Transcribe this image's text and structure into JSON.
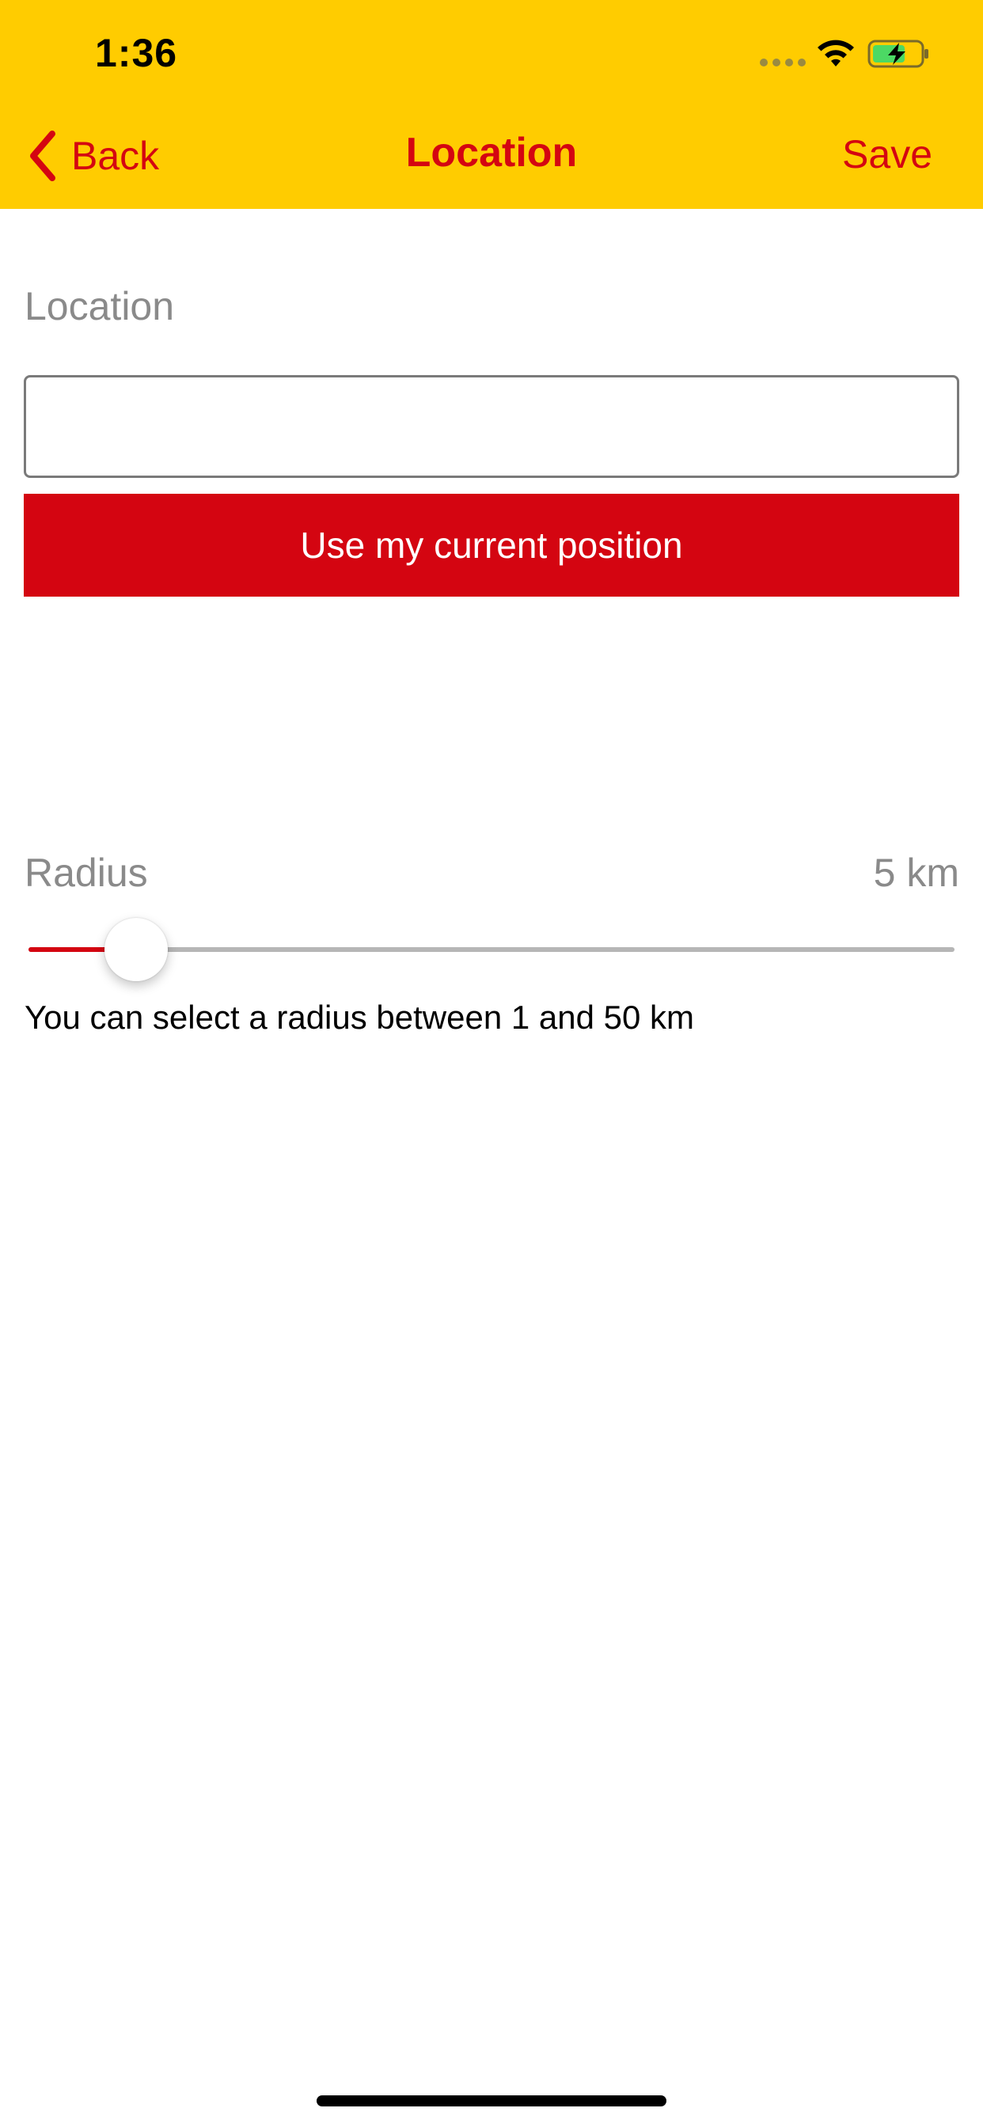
{
  "status_bar": {
    "time": "1:36",
    "icons": [
      "cellular-signal-icon",
      "wifi-icon",
      "battery-charging-icon"
    ],
    "battery_color": "#4CD964"
  },
  "nav": {
    "back_label": "Back",
    "title": "Location",
    "save_label": "Save"
  },
  "location": {
    "label": "Location",
    "value": "",
    "placeholder": "",
    "current_position_label": "Use my current position"
  },
  "radius": {
    "label": "Radius",
    "value_text": "5 km",
    "value": 5,
    "min": 1,
    "max": 50,
    "help_text": "You can select a radius between 1 and 50 km"
  },
  "colors": {
    "header_bg": "#FFCC00",
    "accent": "#D40511",
    "muted_text": "#8a8a8a"
  }
}
